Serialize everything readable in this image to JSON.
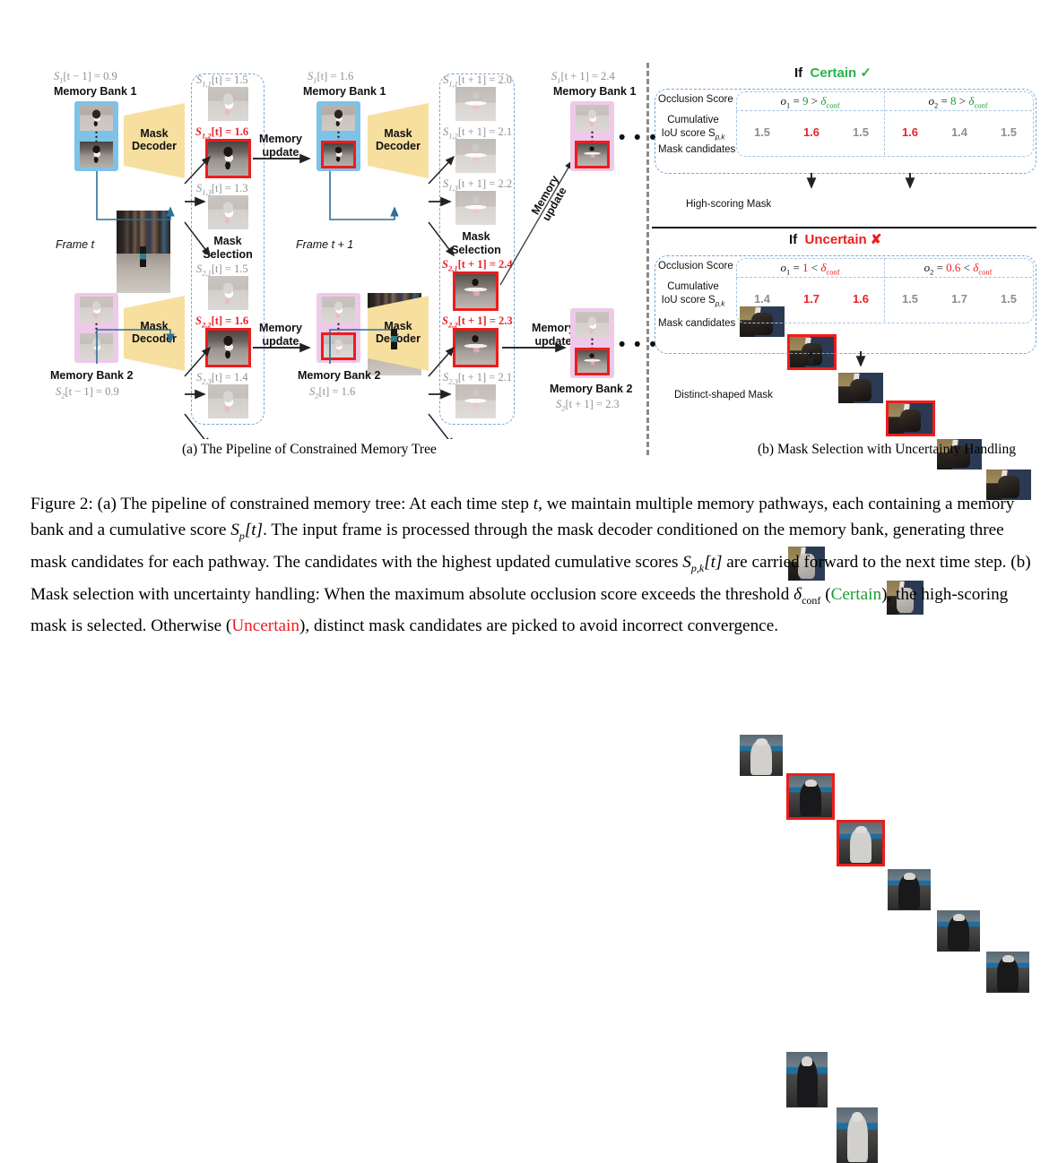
{
  "figure": {
    "number": "Figure 2:",
    "caption_parts": {
      "p1": "(a) The pipeline of constrained memory tree: At each time step ",
      "t1": "t",
      "p2": ", we maintain multiple memory pathways, each containing a memory bank and a cumulative score ",
      "s1": "S",
      "s1sub": "p",
      "s1b": "[t]",
      "p3": ". The input frame is processed through the mask decoder conditioned on the memory bank, generating three mask candidates for each pathway. The candidates with the highest updated cumulative scores ",
      "s2": "S",
      "s2sub": "p,k",
      "s2b": "[t]",
      "p4": " are carried forward to the next time step. (b) Mask selection with uncertainty handling: When the maximum absolute occlusion score exceeds the threshold ",
      "delta": "δ",
      "deltasub": "conf",
      "p5": " (",
      "certain": "Certain",
      "p6": "), the high-scoring mask is selected. Otherwise (",
      "uncertain": "Uncertain",
      "p7": "), distinct mask candidates are picked to avoid incorrect convergence."
    },
    "subcaption_a": "(a) The Pipeline of Constrained Memory Tree",
    "subcaption_b": "(b) Mask Selection with Uncertainty Handling"
  },
  "colors": {
    "memory_bank_1": "#7dc3e7",
    "memory_bank_2": "#efc9e9",
    "decoder": "#f7dfa0",
    "selected_border": "#ee1c1c",
    "dashed_group": "#7aa6d8",
    "certain_green": "#29b34a",
    "uncertain_red": "#ee1c1c",
    "score_grey": "#8f8f8f"
  },
  "panel_a": {
    "stage_t": {
      "bank1": {
        "score_label": "S₁[t − 1] = 0.9",
        "score_parts": {
          "S": "S",
          "sub": "1",
          "br": "[t − 1] = 0.9"
        },
        "title": "Memory Bank 1"
      },
      "bank2": {
        "title": "Memory Bank 2",
        "score_parts": {
          "S": "S",
          "sub": "2",
          "br": "[t − 1] = 0.9"
        }
      },
      "frame_label": "Frame t",
      "decoder_line1": "Mask",
      "decoder_line2": "Decoder",
      "mask_selection_line1": "Mask",
      "mask_selection_line2": "Selection",
      "memory_update_line1": "Memory",
      "memory_update_line2": "update",
      "candidates": [
        {
          "S": "S",
          "sub": "1,1",
          "br": "[t] = 1.5",
          "selected": false
        },
        {
          "S": "S",
          "sub": "1,2",
          "br": "[t] = 1.6",
          "selected": true
        },
        {
          "S": "S",
          "sub": "1,3",
          "br": "[t] = 1.3",
          "selected": false
        },
        {
          "S": "S",
          "sub": "2,1",
          "br": "[t] = 1.5",
          "selected": false
        },
        {
          "S": "S",
          "sub": "2,2",
          "br": "[t] = 1.6",
          "selected": true
        },
        {
          "S": "S",
          "sub": "2,3",
          "br": "[t] = 1.4",
          "selected": false
        }
      ]
    },
    "stage_t1": {
      "bank1": {
        "title": "Memory Bank 1",
        "score_parts": {
          "S": "S",
          "sub": "1",
          "br": "[t] = 1.6"
        }
      },
      "bank2": {
        "title": "Memory Bank 2",
        "score_parts": {
          "S": "S",
          "sub": "2",
          "br": "[t] = 1.6"
        }
      },
      "frame_label": "Frame t + 1",
      "decoder_line1": "Mask",
      "decoder_line2": "Decoder",
      "mask_selection_line1": "Mask",
      "mask_selection_line2": "Selection",
      "memory_update_line1": "Memory",
      "memory_update_line2": "update",
      "diag_update_line1": "Memory",
      "diag_update_line2": "update",
      "candidates": [
        {
          "S": "S",
          "sub": "1,1",
          "br": "[t + 1] = 2.0",
          "selected": false
        },
        {
          "S": "S",
          "sub": "1,2",
          "br": "[t + 1] = 2.1",
          "selected": false
        },
        {
          "S": "S",
          "sub": "1,3",
          "br": "[t + 1] = 2.2",
          "selected": false
        },
        {
          "S": "S",
          "sub": "2,1",
          "br": "[t + 1] = 2.4",
          "selected": true
        },
        {
          "S": "S",
          "sub": "2,2",
          "br": "[t + 1] = 2.3",
          "selected": true
        },
        {
          "S": "S",
          "sub": "2,3",
          "br": "[t + 1] = 2.1",
          "selected": false
        }
      ]
    },
    "stage_out": {
      "bank1": {
        "title": "Memory Bank 1",
        "score_parts": {
          "S": "S",
          "sub": "1",
          "br": "[t + 1] = 2.4"
        }
      },
      "bank2": {
        "title": "Memory Bank 2",
        "score_parts": {
          "S": "S",
          "sub": "2",
          "br": "[t + 1] = 2.3"
        }
      },
      "ellipsis": "• • •"
    }
  },
  "panel_b": {
    "certain": {
      "header_if": "If",
      "header_label": "Certain",
      "header_mark": "✓",
      "row_labels": {
        "occlusion": "Occlusion Score",
        "cumulative_line1": "Cumulative",
        "cumulative_line2": "IoU score S",
        "cumulative_sub": "p,k",
        "candidates": "Mask candidates",
        "result": "High-scoring Mask"
      },
      "groups": [
        {
          "occlusion": {
            "o": "o",
            "sub": "1",
            "eq": " = ",
            "val": "9",
            "cmp": " > ",
            "d": "δ",
            "dsub": "conf"
          },
          "scores": [
            {
              "value": "1.5",
              "selected": false
            },
            {
              "value": "1.6",
              "selected": true
            },
            {
              "value": "1.5",
              "selected": false
            }
          ]
        },
        {
          "occlusion": {
            "o": "o",
            "sub": "2",
            "eq": " = ",
            "val": "8",
            "cmp": " > ",
            "d": "δ",
            "dsub": "conf"
          },
          "scores": [
            {
              "value": "1.6",
              "selected": true
            },
            {
              "value": "1.4",
              "selected": false
            },
            {
              "value": "1.5",
              "selected": false
            }
          ]
        }
      ]
    },
    "uncertain": {
      "header_if": "If",
      "header_label": "Uncertain",
      "header_mark": "✘",
      "row_labels": {
        "occlusion": "Occlusion Score",
        "cumulative_line1": "Cumulative",
        "cumulative_line2": "IoU score S",
        "cumulative_sub": "p,k",
        "candidates": "Mask candidates",
        "result": "Distinct-shaped Mask"
      },
      "groups": [
        {
          "occlusion": {
            "o": "o",
            "sub": "1",
            "eq": " = ",
            "val": "1",
            "cmp": " < ",
            "d": "δ",
            "dsub": "conf"
          },
          "scores": [
            {
              "value": "1.4",
              "selected": false
            },
            {
              "value": "1.7",
              "selected": true
            },
            {
              "value": "1.6",
              "selected": true
            }
          ]
        },
        {
          "occlusion": {
            "o": "o",
            "sub": "2",
            "eq": " = ",
            "val": "0.6",
            "cmp": " < ",
            "d": "δ",
            "dsub": "conf"
          },
          "scores": [
            {
              "value": "1.5",
              "selected": false
            },
            {
              "value": "1.7",
              "selected": false
            },
            {
              "value": "1.5",
              "selected": false
            }
          ]
        }
      ]
    }
  }
}
